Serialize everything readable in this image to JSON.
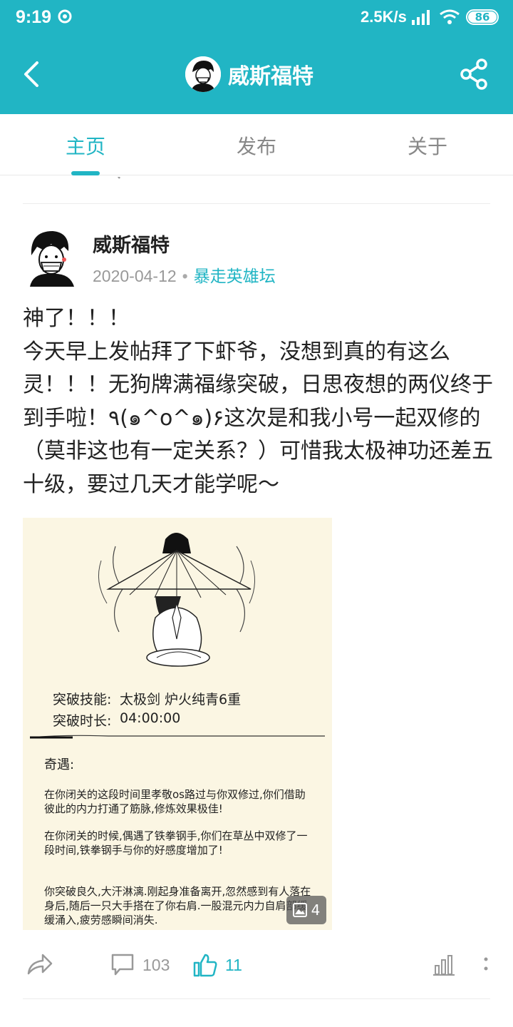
{
  "status_bar": {
    "time": "9:19",
    "net_speed": "2.5K/s",
    "battery": "86"
  },
  "header": {
    "title": "威斯福特",
    "icons": [
      "back-arrow-icon",
      "share-icon"
    ]
  },
  "tabs": [
    {
      "label": "主页",
      "active": true
    },
    {
      "label": "发布",
      "active": false
    },
    {
      "label": "关于",
      "active": false
    }
  ],
  "post": {
    "author": "威斯福特",
    "date": "2020-04-12",
    "separator": "•",
    "forum": "暴走英雄坛",
    "body": "神了！！！\n今天早上发帖拜了下虾爷，没想到真的有这么灵！！！无狗牌满福缘突破，日思夜想的两仪终于到手啦！٩(๑^o^๑)۶这次是和我小号一起双修的（莫非这也有一定关系？）可惜我太极神功还差五十级，要过几天才能学呢～",
    "image": {
      "skill_label": "突破技能:",
      "skill_value": "太极剑  炉火纯青6重",
      "time_label": "突破时长:",
      "time_value": "04:00:00",
      "encounter_title": "奇遇:",
      "para1": "在你闭关的这段时间里孝敬os路过与你双修过,你们借助彼此的内力打通了筋脉,修炼效果极佳!",
      "para2": "在你闭关的时候,偶遇了铁拳钢手,你们在草丛中双修了一段时间,铁拳钢手与你的好感度增加了!",
      "para3": "你突破良久,大汗淋漓.刚起身准备离开,忽然感到有人落在身后,随后一只大手搭在了你右肩.一股混元内力自肩部缓缓涌入,疲劳感瞬间消失.",
      "count": "4"
    },
    "comments": "103",
    "likes": "11"
  },
  "accent_color": "#21b5c4"
}
